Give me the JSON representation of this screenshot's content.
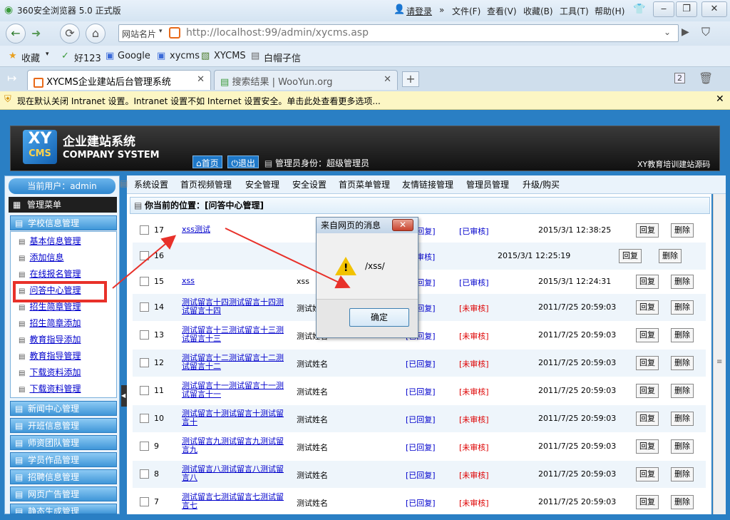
{
  "browser": {
    "title": "360安全浏览器 5.0 正式版",
    "login": "请登录",
    "menus": [
      "文件(F)",
      "查看(V)",
      "收藏(B)",
      "工具(T)",
      "帮助(H)"
    ],
    "site_name": "网站名片",
    "url": "http://localhost:99/admin/xycms.asp",
    "favorites": [
      "收藏",
      "好123",
      "Google",
      "xycms",
      "XYCMS",
      "白帽子信"
    ],
    "tabs": [
      "XYCMS企业建站后台管理系统",
      "搜索结果 | WooYun.org"
    ],
    "info_bar": "现在默认关闭 Intranet 设置。Intranet 设置不如 Internet 设置安全。单击此处查看更多选项...",
    "tab_count": "2"
  },
  "header": {
    "logo_top": "XY",
    "logo_bottom": "CMS",
    "cn_title": "企业建站系统",
    "en_title": "COMPANY SYSTEM",
    "home": "首页",
    "logout": "退出",
    "admin_identity": "管理员身份：超级管理员",
    "right_text": "XY教育培训建站源码"
  },
  "sidebar": {
    "current_user": "当前用户：admin",
    "menu_title": "管理菜单",
    "groups": [
      "学校信息管理",
      "新闻中心管理",
      "开班信息管理",
      "师资团队管理",
      "学员作品管理",
      "招聘信息管理",
      "网页广告管理",
      "静态生成管理"
    ],
    "subitems": [
      "基本信息管理",
      "添加信息",
      "在线报名管理",
      "问答中心管理",
      "招生简章管理",
      "招生简章添加",
      "教育指导添加",
      "教育指导管理",
      "下载资料添加",
      "下载资料管理"
    ]
  },
  "top_menu": [
    "系统设置",
    "首页视频管理",
    "安全管理",
    "安全设置",
    "首页菜单管理",
    "友情链接管理",
    "管理员管理",
    "升级/购买"
  ],
  "location": "你当前的位置：[问答中心管理]",
  "rows": [
    {
      "id": "17",
      "title": "xss测试",
      "name": "",
      "reply": "[已回复]",
      "status": "[已审核]",
      "date": "2015/3/1 12:38:25",
      "approved": true
    },
    {
      "id": "16",
      "title": "",
      "name": "",
      "reply": "",
      "status": "审核]",
      "date": "2015/3/1 12:25:19",
      "approved": true
    },
    {
      "id": "15",
      "title": "xss",
      "name": "xss",
      "reply": "[已回复]",
      "status": "[已审核]",
      "date": "2015/3/1 12:24:31",
      "approved": true
    },
    {
      "id": "14",
      "title": "测试留言十四测试留言十四测试留言十四",
      "name": "测试姓名",
      "reply": "[已回复]",
      "status": "[未审核]",
      "date": "2011/7/25 20:59:03",
      "approved": false
    },
    {
      "id": "13",
      "title": "测试留言十三测试留言十三测试留言十三",
      "name": "测试姓名",
      "reply": "[已回复]",
      "status": "[未审核]",
      "date": "2011/7/25 20:59:03",
      "approved": false
    },
    {
      "id": "12",
      "title": "测试留言十二测试留言十二测试留言十二",
      "name": "测试姓名",
      "reply": "[已回复]",
      "status": "[未审核]",
      "date": "2011/7/25 20:59:03",
      "approved": false
    },
    {
      "id": "11",
      "title": "测试留言十一测试留言十一测试留言十一",
      "name": "测试姓名",
      "reply": "[已回复]",
      "status": "[未审核]",
      "date": "2011/7/25 20:59:03",
      "approved": false
    },
    {
      "id": "10",
      "title": "测试留言十测试留言十测试留言十",
      "name": "测试姓名",
      "reply": "[已回复]",
      "status": "[未审核]",
      "date": "2011/7/25 20:59:03",
      "approved": false
    },
    {
      "id": "9",
      "title": "测试留言九测试留言九测试留言九",
      "name": "测试姓名",
      "reply": "[已回复]",
      "status": "[未审核]",
      "date": "2011/7/25 20:59:03",
      "approved": false
    },
    {
      "id": "8",
      "title": "测试留言八测试留言八测试留言八",
      "name": "测试姓名",
      "reply": "[已回复]",
      "status": "[未审核]",
      "date": "2011/7/25 20:59:03",
      "approved": false
    },
    {
      "id": "7",
      "title": "测试留言七测试留言七测试留言七",
      "name": "测试姓名",
      "reply": "[已回复]",
      "status": "[未审核]",
      "date": "2011/7/25 20:59:03",
      "approved": false
    }
  ],
  "buttons": {
    "reply": "回复",
    "delete": "删除"
  },
  "dialog": {
    "title": "来自网页的消息",
    "message": "/xss/",
    "ok": "确定",
    "close": "✕"
  },
  "colors": {
    "accent": "#2a7fc4",
    "annotation": "#e8312a"
  }
}
